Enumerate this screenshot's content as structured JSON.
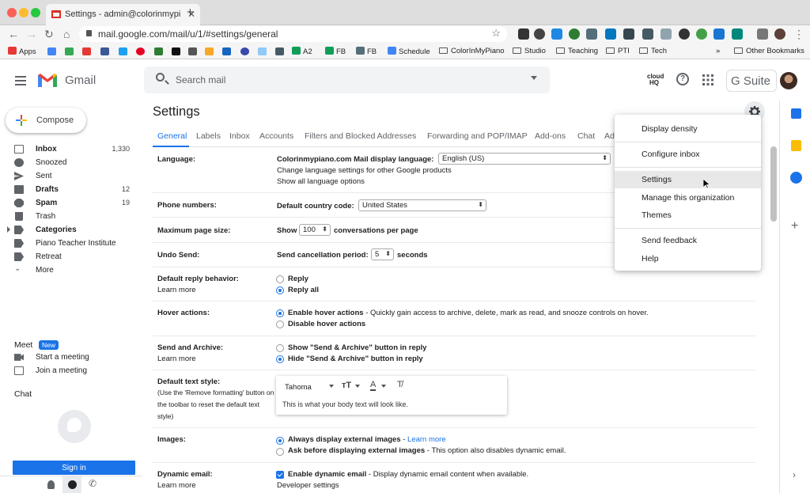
{
  "browser": {
    "tab_title": "Settings - admin@colorinmypi",
    "url": "mail.google.com/mail/u/1/#settings/general",
    "bookmarks": [
      "Apps",
      "A2",
      "FB",
      "FB",
      "Schedule",
      "ColorInMyPiano",
      "Studio",
      "Teaching",
      "PTI",
      "Tech",
      "Other Bookmarks"
    ],
    "overflow": "»"
  },
  "header": {
    "app_name": "Gmail",
    "search_placeholder": "Search mail",
    "cloudhq": "cloud HQ",
    "gsuite": "G Suite"
  },
  "sidebar": {
    "compose": "Compose",
    "items": [
      {
        "label": "Inbox",
        "count": "1,330",
        "bold": true
      },
      {
        "label": "Snoozed",
        "count": ""
      },
      {
        "label": "Sent",
        "count": ""
      },
      {
        "label": "Drafts",
        "count": "12",
        "bold": true
      },
      {
        "label": "Spam",
        "count": "19",
        "bold": true
      },
      {
        "label": "Trash",
        "count": ""
      },
      {
        "label": "Categories",
        "count": "",
        "bold": true
      },
      {
        "label": "Piano Teacher Institute",
        "count": ""
      },
      {
        "label": "Retreat",
        "count": ""
      },
      {
        "label": "More",
        "count": ""
      }
    ],
    "meet_title": "Meet",
    "meet_badge": "New",
    "meet_start": "Start a meeting",
    "meet_join": "Join a meeting",
    "chat_title": "Chat",
    "sign_in": "Sign in"
  },
  "settings": {
    "title": "Settings",
    "tabs": [
      "General",
      "Labels",
      "Inbox",
      "Accounts",
      "Filters and Blocked Addresses",
      "Forwarding and POP/IMAP",
      "Add-ons",
      "Chat",
      "Ad"
    ],
    "language": {
      "label": "Language:",
      "display_label": "Colorinmypiano.com Mail display language:",
      "value": "English (US)",
      "link1": "Change language settings for other Google products",
      "link2": "Show all language options"
    },
    "phone": {
      "label": "Phone numbers:",
      "field": "Default country code:",
      "value": "United States"
    },
    "page_size": {
      "label": "Maximum page size:",
      "prefix": "Show",
      "value": "100",
      "suffix": "conversations per page"
    },
    "undo": {
      "label": "Undo Send:",
      "prefix": "Send cancellation period:",
      "value": "5",
      "suffix": "seconds"
    },
    "reply": {
      "label": "Default reply behavior:",
      "learn": "Learn more",
      "opt1": "Reply",
      "opt2": "Reply all"
    },
    "hover": {
      "label": "Hover actions:",
      "opt1": "Enable hover actions",
      "opt1_desc": " - Quickly gain access to archive, delete, mark as read, and snooze controls on hover.",
      "opt2": "Disable hover actions"
    },
    "send_archive": {
      "label": "Send and Archive:",
      "learn": "Learn more",
      "opt1": "Show \"Send & Archive\" button in reply",
      "opt2": "Hide \"Send & Archive\" button in reply"
    },
    "text_style": {
      "label": "Default text style:",
      "note": "(Use the 'Remove formatting' button on the toolbar to reset the default text style)",
      "font": "Tahoma",
      "preview": "This is what your body text will look like."
    },
    "images": {
      "label": "Images:",
      "opt1": "Always display external images",
      "opt1_link": "Learn more",
      "opt2": "Ask before displaying external images",
      "opt2_desc": " - This option also disables dynamic email."
    },
    "dynamic": {
      "label": "Dynamic email:",
      "learn": "Learn more",
      "opt": "Enable dynamic email",
      "opt_desc": " - Display dynamic email content when available.",
      "dev": "Developer settings"
    }
  },
  "menu": {
    "items": [
      "Display density",
      "Configure inbox",
      "Settings",
      "Manage this organization",
      "Themes",
      "Send feedback",
      "Help"
    ]
  },
  "colors": {
    "accent": "#1a73e8",
    "gmail_red": "#ea4335"
  }
}
